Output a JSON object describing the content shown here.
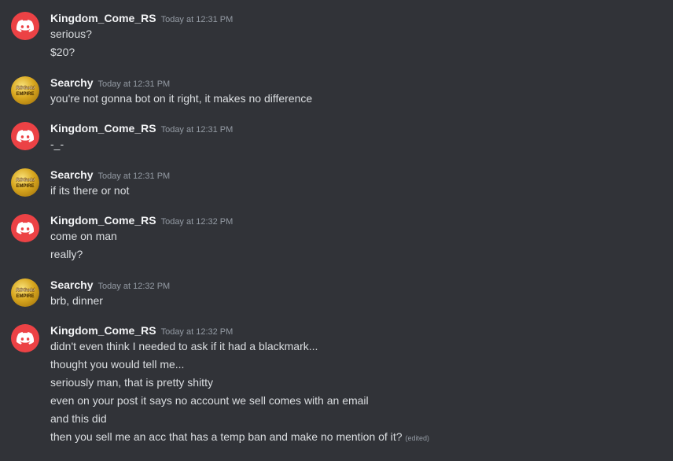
{
  "messages": [
    {
      "author": "Kingdom_Come_RS",
      "avatar_icon": "discord-logo-icon",
      "timestamp": "Today at 12:31 PM",
      "lines": [
        "serious?",
        "$20?"
      ]
    },
    {
      "author": "Searchy",
      "avatar_icon": "rsgold-empire-logo-icon",
      "avatar_text": [
        "RSGold",
        "EMPIRE"
      ],
      "timestamp": "Today at 12:31 PM",
      "lines": [
        "you're not gonna bot on it right, it makes no difference"
      ]
    },
    {
      "author": "Kingdom_Come_RS",
      "avatar_icon": "discord-logo-icon",
      "timestamp": "Today at 12:31 PM",
      "lines": [
        "-_-"
      ]
    },
    {
      "author": "Searchy",
      "avatar_icon": "rsgold-empire-logo-icon",
      "avatar_text": [
        "RSGold",
        "EMPIRE"
      ],
      "timestamp": "Today at 12:31 PM",
      "lines": [
        "if its there or not"
      ]
    },
    {
      "author": "Kingdom_Come_RS",
      "avatar_icon": "discord-logo-icon",
      "timestamp": "Today at 12:32 PM",
      "lines": [
        "come on man",
        "really?"
      ]
    },
    {
      "author": "Searchy",
      "avatar_icon": "rsgold-empire-logo-icon",
      "avatar_text": [
        "RSGold",
        "EMPIRE"
      ],
      "timestamp": "Today at 12:32 PM",
      "lines": [
        "brb, dinner"
      ]
    },
    {
      "author": "Kingdom_Come_RS",
      "avatar_icon": "discord-logo-icon",
      "timestamp": "Today at 12:32 PM",
      "lines": [
        "didn't even think I needed to ask if it had a blackmark...",
        "thought you would tell me...",
        "seriously man, that is pretty shitty",
        "even on your post it says no account we sell comes with an email",
        "and this did",
        "then you sell me an acc that has a temp ban and make no mention of it?"
      ],
      "edited_label": "(edited)"
    }
  ],
  "colors": {
    "background": "#313338",
    "discord_avatar": "#ec4245",
    "author": "#f2f3f5",
    "text": "#dbdee1",
    "muted": "#949ba4"
  }
}
